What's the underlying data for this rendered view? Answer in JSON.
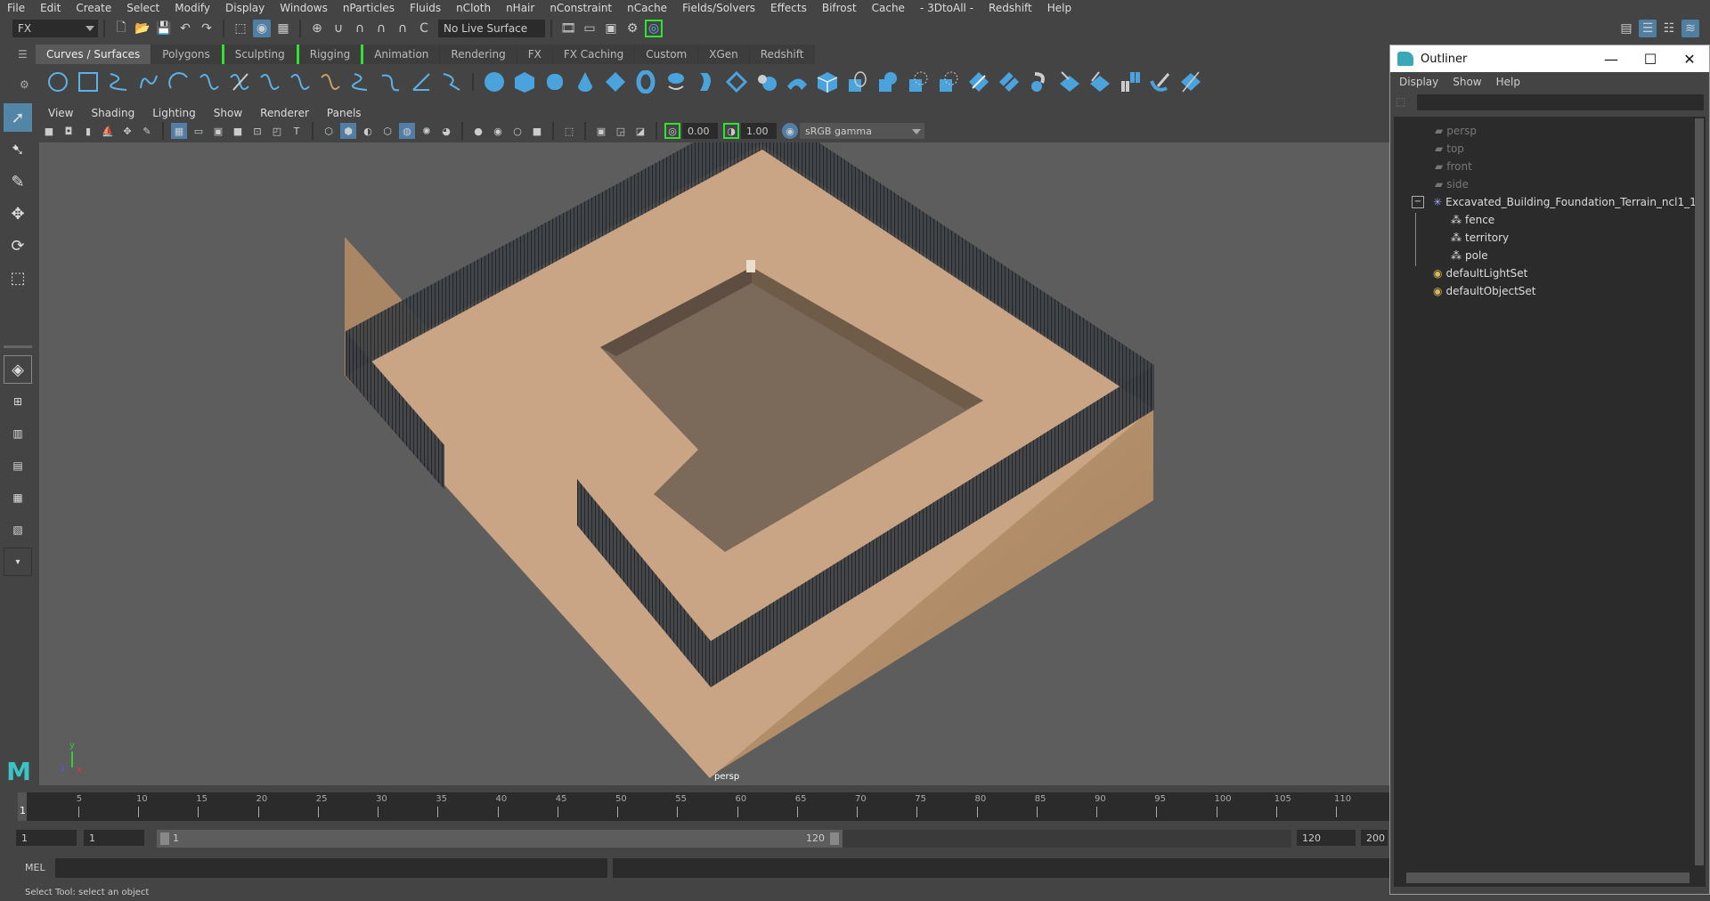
{
  "menu": [
    "File",
    "Edit",
    "Create",
    "Select",
    "Modify",
    "Display",
    "Windows",
    "nParticles",
    "Fluids",
    "nCloth",
    "nHair",
    "nConstraint",
    "nCache",
    "Fields/Solvers",
    "Effects",
    "Bifrost",
    "Cache",
    "- 3DtoAll -",
    "Redshift",
    "Help"
  ],
  "status_line": {
    "menu_set": "FX",
    "live_surface": "No Live Surface"
  },
  "shelf_tabs": [
    "Curves / Surfaces",
    "Polygons",
    "Sculpting",
    "Rigging",
    "Animation",
    "Rendering",
    "FX",
    "FX Caching",
    "Custom",
    "XGen",
    "Redshift"
  ],
  "shelf_active_tab": "Curves / Surfaces",
  "panel_menu": [
    "View",
    "Shading",
    "Lighting",
    "Show",
    "Renderer",
    "Panels"
  ],
  "panel_toolbar": {
    "exposure": "0.00",
    "gamma": "1.00",
    "color_space": "sRGB gamma"
  },
  "viewport": {
    "camera_label": "persp",
    "axis": {
      "x": "x",
      "y": "y",
      "z": "z"
    }
  },
  "timeline": {
    "ticks": [
      "5",
      "10",
      "15",
      "20",
      "25",
      "30",
      "35",
      "40",
      "45",
      "50",
      "55",
      "60",
      "65",
      "70",
      "75",
      "80",
      "85",
      "90",
      "95",
      "100",
      "105",
      "110"
    ],
    "current_frame": "1"
  },
  "range": {
    "start_time": "1",
    "playback_start": "1",
    "slider_start": "1",
    "slider_end": "120",
    "playback_end": "120",
    "end_time": "200"
  },
  "command_line": {
    "language": "MEL"
  },
  "help_line": "Select Tool: select an object",
  "outliner": {
    "title": "Outliner",
    "menu": [
      "Display",
      "Show",
      "Help"
    ],
    "items": [
      {
        "label": "persp",
        "type": "camera",
        "dim": true
      },
      {
        "label": "top",
        "type": "camera",
        "dim": true
      },
      {
        "label": "front",
        "type": "camera",
        "dim": true
      },
      {
        "label": "side",
        "type": "camera",
        "dim": true
      },
      {
        "label": "Excavated_Building_Foundation_Terrain_ncl1_1",
        "type": "group",
        "expanded": true
      },
      {
        "label": "fence",
        "type": "mesh",
        "child": true
      },
      {
        "label": "territory",
        "type": "mesh",
        "child": true
      },
      {
        "label": "pole",
        "type": "mesh",
        "child": true
      },
      {
        "label": "defaultLightSet",
        "type": "set"
      },
      {
        "label": "defaultObjectSet",
        "type": "set"
      }
    ]
  }
}
